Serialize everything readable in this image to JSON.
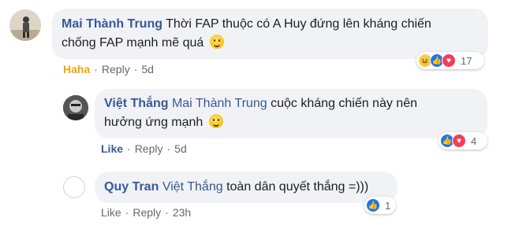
{
  "comments": [
    {
      "author": "Mai Thành Trung",
      "text_line1": "Thời FAP thuộc có A Huy đứng lên kháng chiến",
      "text_line2": "chống FAP mạnh mẽ quá",
      "reaction_action": "Haha",
      "reply_label": "Reply",
      "time": "5d",
      "reaction_count": "17",
      "reaction_icons": [
        "haha-icon",
        "like-icon",
        "love-icon"
      ]
    },
    {
      "author": "Việt Thắng",
      "mention": "Mai Thành Trung",
      "text_line1": "cuộc kháng chiến này nên",
      "text_line2": "hưởng ứng mạnh",
      "reaction_action": "Like",
      "reply_label": "Reply",
      "time": "5d",
      "reaction_count": "4",
      "reaction_icons": [
        "like-icon",
        "love-icon"
      ]
    },
    {
      "author": "Quy Tran",
      "mention": "Việt Thắng",
      "text": "toàn dân quyết thắng =)))",
      "reaction_action": "Like",
      "reply_label": "Reply",
      "time": "23h",
      "reaction_count": "1",
      "reaction_icons": [
        "like-icon"
      ]
    }
  ],
  "colors": {
    "author": "#385898",
    "haha_action": "#e7a800",
    "like_blue": "#1877f2",
    "love_red": "#f33e58",
    "bubble_bg": "#f0f2f5"
  }
}
